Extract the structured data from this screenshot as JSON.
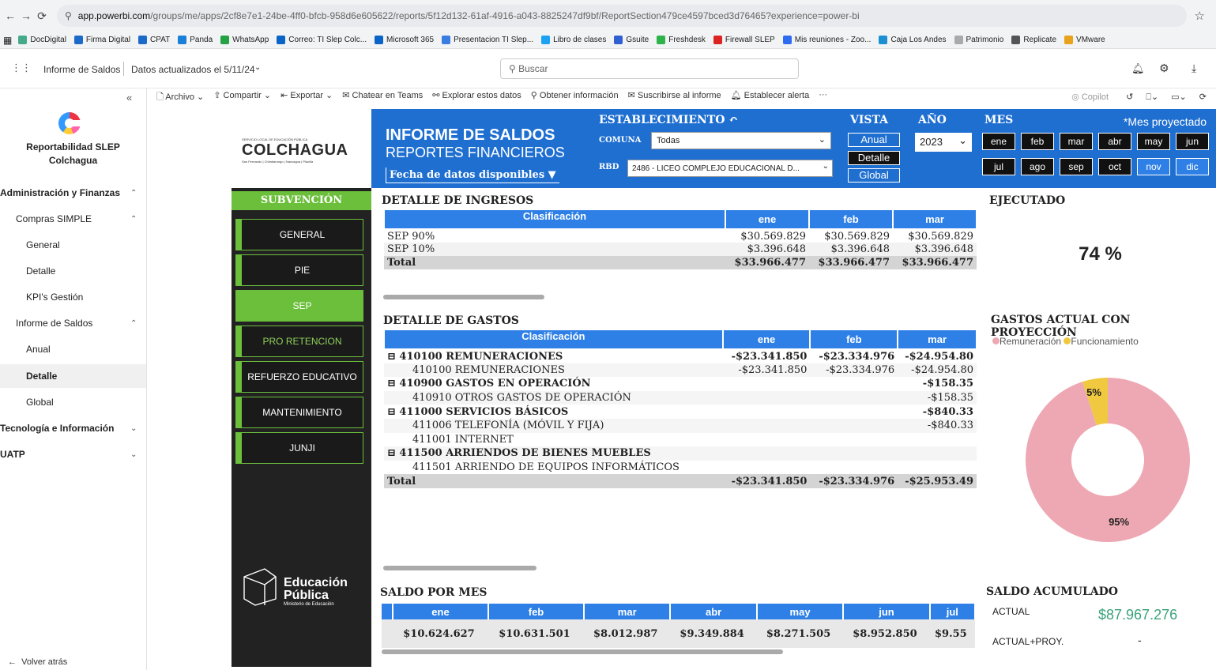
{
  "browser": {
    "url_host": "app.powerbi.com",
    "url_path": "/groups/me/apps/2cf8e7e1-24be-4ff0-bfcb-958d6e605622/reports/5f12d132-61af-4916-a043-8825247df9bf/ReportSection479ce4597bced3d76465?experience=power-bi",
    "bookmarks": [
      {
        "label": "DocDigital",
        "color": "#4a8"
      },
      {
        "label": "Firma Digital",
        "color": "#1b6ac9"
      },
      {
        "label": "CPAT",
        "color": "#1b6ac9"
      },
      {
        "label": "Panda",
        "color": "#1a7fd6"
      },
      {
        "label": "WhatsApp",
        "color": "#25a244"
      },
      {
        "label": "Correo: TI Slep Colc...",
        "color": "#0a64c8"
      },
      {
        "label": "Microsoft 365",
        "color": "#0a64c8"
      },
      {
        "label": "Presentacion TI Slep...",
        "color": "#3a7de0"
      },
      {
        "label": "Libro de clases",
        "color": "#1da1f2"
      },
      {
        "label": "Gsuite",
        "color": "#2f5fd1"
      },
      {
        "label": "Freshdesk",
        "color": "#2db34a"
      },
      {
        "label": "Firewall SLEP",
        "color": "#d22"
      },
      {
        "label": "Mis reuniones - Zoo...",
        "color": "#2d6cf0"
      },
      {
        "label": "Caja Los Andes",
        "color": "#1c8fd3"
      },
      {
        "label": "Patrimonio",
        "color": "#aaa"
      },
      {
        "label": "Replicate",
        "color": "#555"
      },
      {
        "label": "VMware",
        "color": "#e8a21c"
      }
    ]
  },
  "pbi": {
    "app_name": "Informe de Saldos",
    "updated": "Datos actualizados el 5/11/24",
    "search_placeholder": "Buscar",
    "toolbar": [
      "Archivo",
      "Compartir",
      "Exportar",
      "Chatear en Teams",
      "Explorar estos datos",
      "Obtener información",
      "Suscribirse al informe",
      "Establecer alerta",
      "···"
    ],
    "copilot": "Copilot"
  },
  "leftnav": {
    "title_line1": "Reportabilidad SLEP",
    "title_line2": "Colchagua",
    "items": [
      {
        "label": "Administración y Finanzas",
        "bold": true,
        "indent": 0
      },
      {
        "label": "Compras SIMPLE",
        "bold": false,
        "indent": 1
      },
      {
        "label": "General",
        "bold": false,
        "indent": 2
      },
      {
        "label": "Detalle",
        "bold": false,
        "indent": 2
      },
      {
        "label": "KPI's Gestión",
        "bold": false,
        "indent": 2
      },
      {
        "label": "Informe de Saldos",
        "bold": false,
        "indent": 1
      },
      {
        "label": "Anual",
        "bold": false,
        "indent": 2
      },
      {
        "label": "Detalle",
        "bold": true,
        "indent": 2,
        "active": true
      },
      {
        "label": "Global",
        "bold": false,
        "indent": 2
      },
      {
        "label": "Tecnología e Información",
        "bold": true,
        "indent": 0
      },
      {
        "label": "UATP",
        "bold": true,
        "indent": 0
      }
    ],
    "back": "Volver atrás"
  },
  "report": {
    "logo_small": "SERVICIO LOCAL DE EDUCACIÓN PÚBLICA",
    "logo_name": "COLCHAGUA",
    "logo_sub": "San Fernando | Chimbarongo | Nancagua | Placilla",
    "title1": "INFORME DE SALDOS",
    "title2": "REPORTES FINANCIEROS",
    "fecha_label": "Fecha de datos disponibles ▼",
    "establecimiento": "ESTABLECIMIENTO",
    "comuna_label": "COMUNA",
    "comuna_value": "Todas",
    "rbd_label": "RBD",
    "rbd_value": "2486 - LICEO COMPLEJO EDUCACIONAL D...",
    "vista_label": "VISTA",
    "vista_options": [
      "Anual",
      "Detalle",
      "Global"
    ],
    "anio_label": "AÑO",
    "anio_value": "2023",
    "mes_label": "MES",
    "mes_proyectado": "*Mes proyectado",
    "months": [
      "ene",
      "feb",
      "mar",
      "abr",
      "may",
      "jun",
      "jul",
      "ago",
      "sep",
      "oct",
      "nov",
      "dic"
    ],
    "subvencion_title": "SUBVENCIÓN",
    "subvenciones": [
      "GENERAL",
      "PIE",
      "SEP",
      "PRO RETENCION",
      "REFUERZO EDUCATIVO",
      "MANTENIMIENTO",
      "JUNJI"
    ],
    "edu_title1": "Educación",
    "edu_title2": "Pública",
    "edu_sub": "Ministerio de Educación"
  },
  "ingresos": {
    "title": "DETALLE DE INGRESOS",
    "headers": [
      "Clasificación",
      "ene",
      "feb",
      "mar"
    ],
    "rows": [
      {
        "label": "SEP 90%",
        "vals": [
          "$30.569.829",
          "$30.569.829",
          "$30.569.829"
        ]
      },
      {
        "label": "SEP 10%",
        "vals": [
          "$3.396.648",
          "$3.396.648",
          "$3.396.648"
        ]
      },
      {
        "label": "Total",
        "vals": [
          "$33.966.477",
          "$33.966.477",
          "$33.966.477"
        ],
        "total": true
      }
    ]
  },
  "gastos": {
    "title": "DETALLE DE GASTOS",
    "headers": [
      "Clasificación",
      "ene",
      "feb",
      "mar"
    ],
    "rows": [
      {
        "label": "⊟ 410100 REMUNERACIONES",
        "vals": [
          "-$23.341.850",
          "-$23.334.976",
          "-$24.954.80"
        ],
        "group": true
      },
      {
        "label": "410100 REMUNERACIONES",
        "vals": [
          "-$23.341.850",
          "-$23.334.976",
          "-$24.954.80"
        ]
      },
      {
        "label": "⊟ 410900 GASTOS EN OPERACIÓN",
        "vals": [
          "",
          "",
          "-$158.35"
        ],
        "group": true
      },
      {
        "label": "410910 OTROS GASTOS DE OPERACIÓN",
        "vals": [
          "",
          "",
          "-$158.35"
        ]
      },
      {
        "label": "⊟ 411000 SERVICIOS BÁSICOS",
        "vals": [
          "",
          "",
          "-$840.33"
        ],
        "group": true
      },
      {
        "label": "411006 TELEFONÍA (MÓVIL Y FIJA)",
        "vals": [
          "",
          "",
          "-$840.33"
        ]
      },
      {
        "label": "411001 INTERNET",
        "vals": [
          "",
          "",
          ""
        ]
      },
      {
        "label": "⊟ 411500 ARRIENDOS DE BIENES MUEBLES",
        "vals": [
          "",
          "",
          ""
        ],
        "group": true
      },
      {
        "label": "411501 ARRIENDO DE EQUIPOS INFORMÁTICOS",
        "vals": [
          "",
          "",
          ""
        ]
      },
      {
        "label": "Total",
        "vals": [
          "-$23.341.850",
          "-$23.334.976",
          "-$25.953.49"
        ],
        "total": true
      }
    ]
  },
  "ejecutado": {
    "title": "EJECUTADO",
    "value": "74 %"
  },
  "gastos_proyeccion": {
    "title": "GASTOS ACTUAL CON PROYECCIÓN",
    "legend": [
      "Remuneración",
      "Funcionamiento"
    ]
  },
  "chart_data": {
    "type": "pie",
    "title": "GASTOS ACTUAL CON PROYECCIÓN",
    "categories": [
      "Remuneración",
      "Funcionamiento"
    ],
    "values": [
      95,
      5
    ],
    "labels": [
      "95%",
      "5%"
    ],
    "colors": [
      "#eea8b3",
      "#f0c940"
    ]
  },
  "saldo_mes": {
    "title": "SALDO POR MES",
    "headers": [
      "ene",
      "feb",
      "mar",
      "abr",
      "may",
      "jun",
      "jul"
    ],
    "values": [
      "$10.624.627",
      "$10.631.501",
      "$8.012.987",
      "$9.349.884",
      "$8.271.505",
      "$8.952.850",
      "$9.55"
    ]
  },
  "saldo_acum": {
    "title": "SALDO ACUMULADO",
    "actual_label": "ACTUAL",
    "actual_value": "$87.967.276",
    "proy_label": "ACTUAL+PROY.",
    "proy_value": "-"
  }
}
